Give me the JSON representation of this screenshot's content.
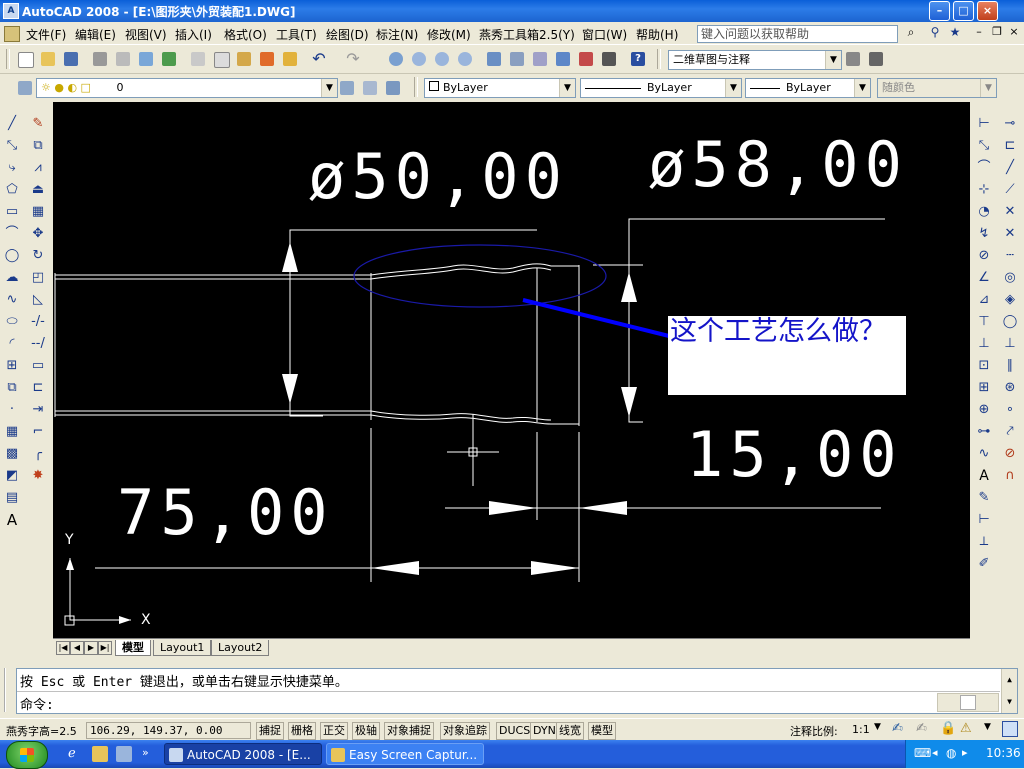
{
  "window": {
    "title": "AutoCAD 2008 - [E:\\图形夹\\外贸装配1.DWG]",
    "buttons": {
      "minimize": "–",
      "maximize": "□",
      "close": "×"
    }
  },
  "menubar": {
    "items": [
      "文件(F)",
      "编辑(E)",
      "视图(V)",
      "插入(I)",
      "格式(O)",
      "工具(T)",
      "绘图(D)",
      "标注(N)",
      "修改(M)",
      "燕秀工具箱2.5(Y)",
      "窗口(W)",
      "帮助(H)"
    ],
    "help_placeholder": "键入问题以获取帮助"
  },
  "toolbar1": {
    "workspace": "二维草图与注释"
  },
  "toolbar2": {
    "layer": "0",
    "color": "ByLayer",
    "linetype": "ByLayer",
    "lineweight": "ByLayer",
    "plotstyle": "随颜色"
  },
  "drawing": {
    "dims": {
      "d50": "ø50,00",
      "d58": "ø58,00",
      "l15": "15,00",
      "l75": "75,00"
    },
    "note": "这个工艺怎么做？",
    "ucs": {
      "x_label": "X",
      "y_label": "Y"
    }
  },
  "layout_tabs": [
    "模型",
    "Layout1",
    "Layout2"
  ],
  "command": {
    "history": "按 Esc 或 Enter 键退出，或单击右键显示快捷菜单。",
    "prompt": "命令:"
  },
  "status": {
    "left_label": "燕秀字高=2.5",
    "coords": "106.29, 149.37, 0.00",
    "toggles": [
      "捕捉",
      "栅格",
      "正交",
      "极轴",
      "对象捕捉",
      "对象追踪",
      "DUCS",
      "DYN",
      "线宽",
      "模型"
    ],
    "annotation_scale_label": "注释比例:",
    "annotation_scale": "1:1"
  },
  "taskbar": {
    "tasks": [
      "AutoCAD 2008 - [E...",
      "Easy Screen Captur..."
    ],
    "clock": "10:36"
  },
  "colors": {
    "canvas_bg": "#000000",
    "geometry": "#ffffff",
    "highlight_ellipse": "#1a1aa8",
    "leader": "#0000ff",
    "note_text": "#1414c8"
  }
}
